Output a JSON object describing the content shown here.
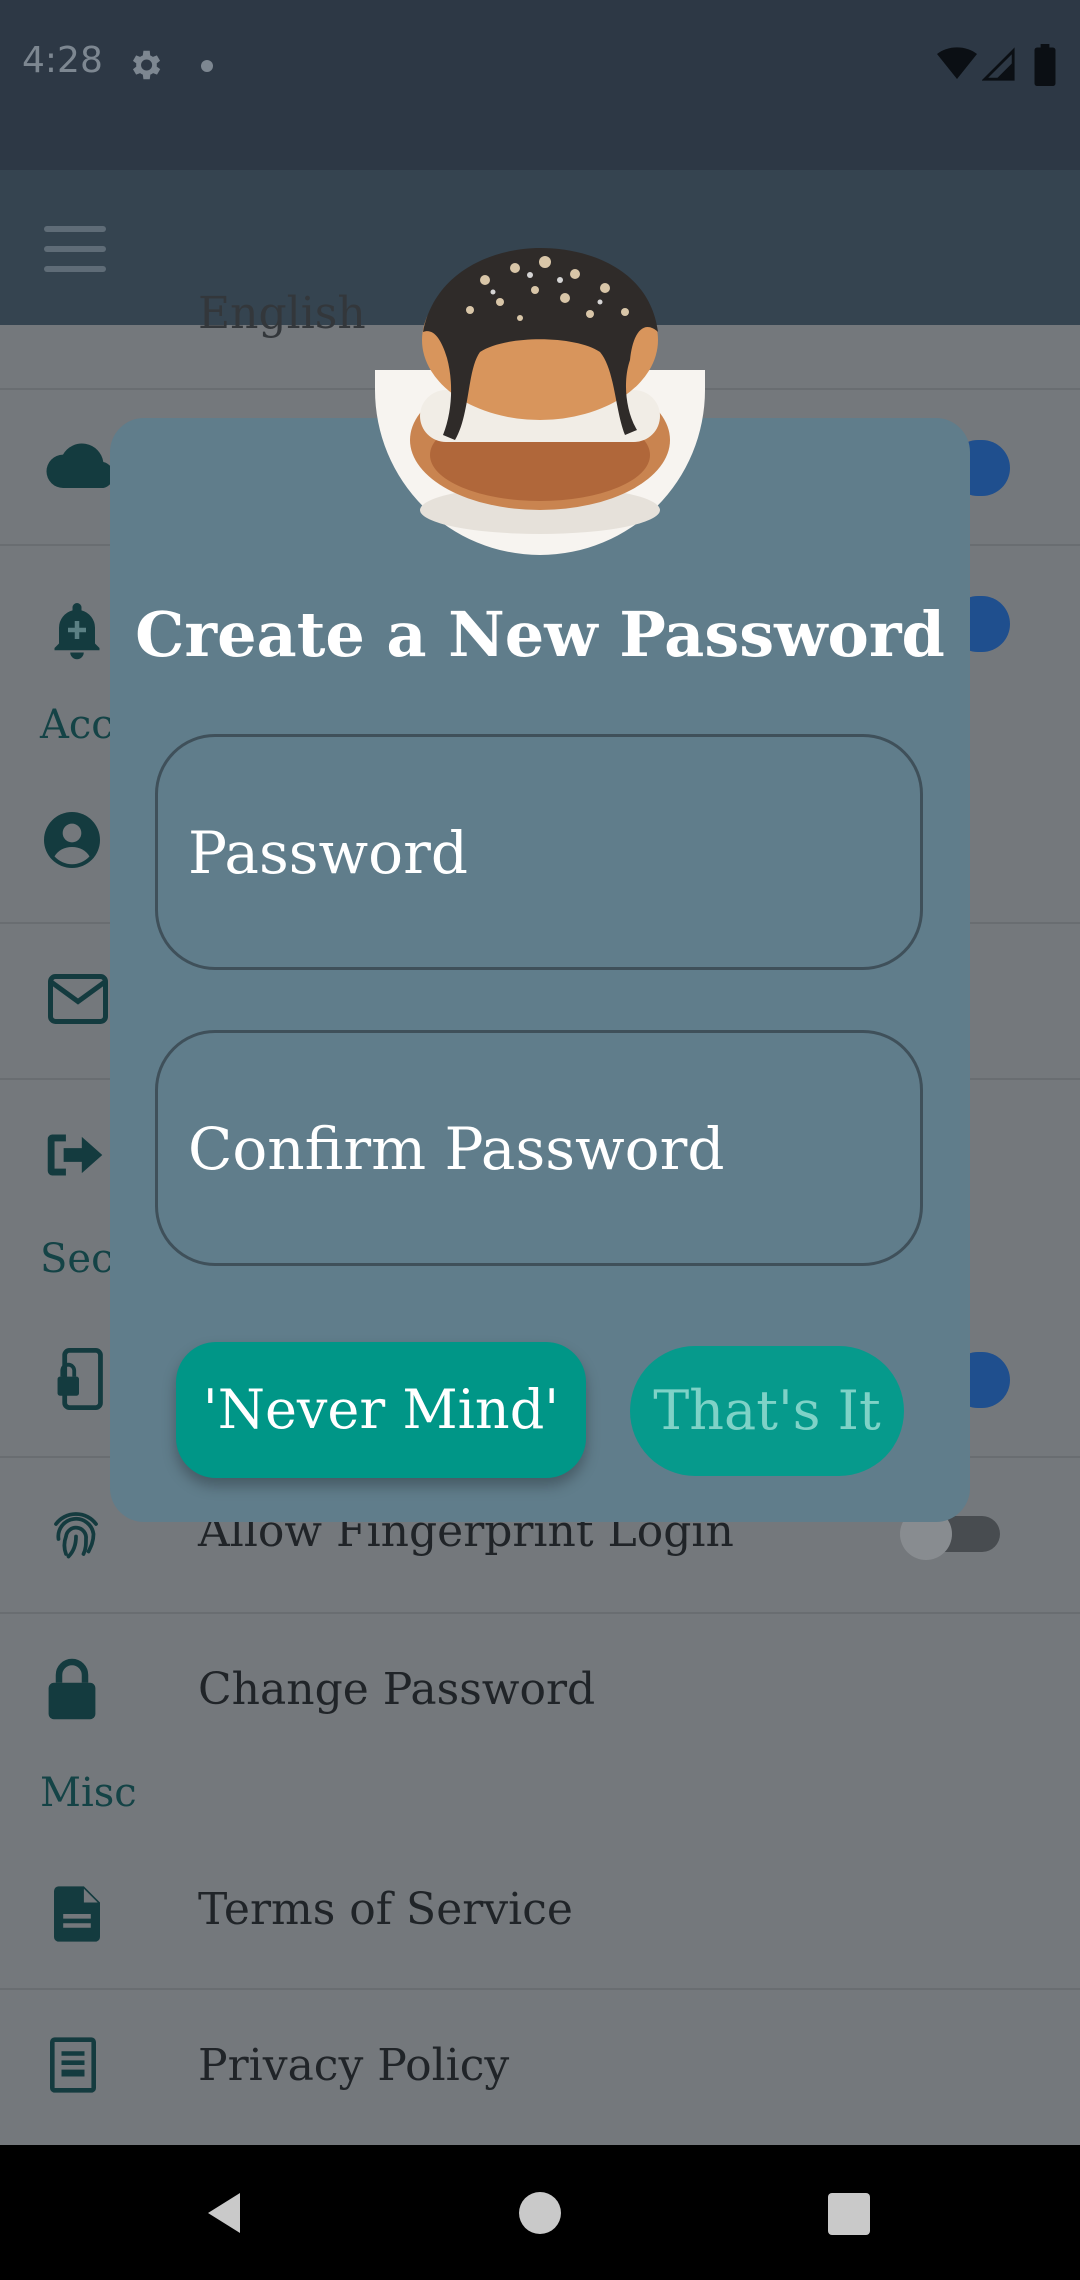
{
  "status_bar": {
    "time": "4:28"
  },
  "settings": {
    "partial_language": "English",
    "sections": {
      "account": "Acc",
      "security": "Sec",
      "misc": "Misc"
    },
    "rows": {
      "fingerprint": "Allow Fingerprint Login",
      "change_password": "Change Password",
      "terms": "Terms of Service",
      "privacy": "Privacy Policy"
    }
  },
  "dialog": {
    "title": "Create a New Password",
    "password_placeholder": "Password",
    "confirm_placeholder": "Confirm Password",
    "cancel_label": "'Never Mind'",
    "confirm_label": "That's It"
  },
  "colors": {
    "dialog_bg": "#607d8b",
    "button_teal": "#009687",
    "switch_on": "#1b5fb8"
  },
  "icons": [
    "settings-icon",
    "dot-icon",
    "wifi-icon",
    "signal-icon",
    "battery-icon",
    "menu-icon",
    "cloud-icon",
    "bell-icon",
    "account-icon",
    "mail-icon",
    "logout-icon",
    "phone-lock-icon",
    "fingerprint-icon",
    "lock-icon",
    "document-icon",
    "policy-icon",
    "back-icon",
    "home-icon",
    "recents-icon"
  ]
}
